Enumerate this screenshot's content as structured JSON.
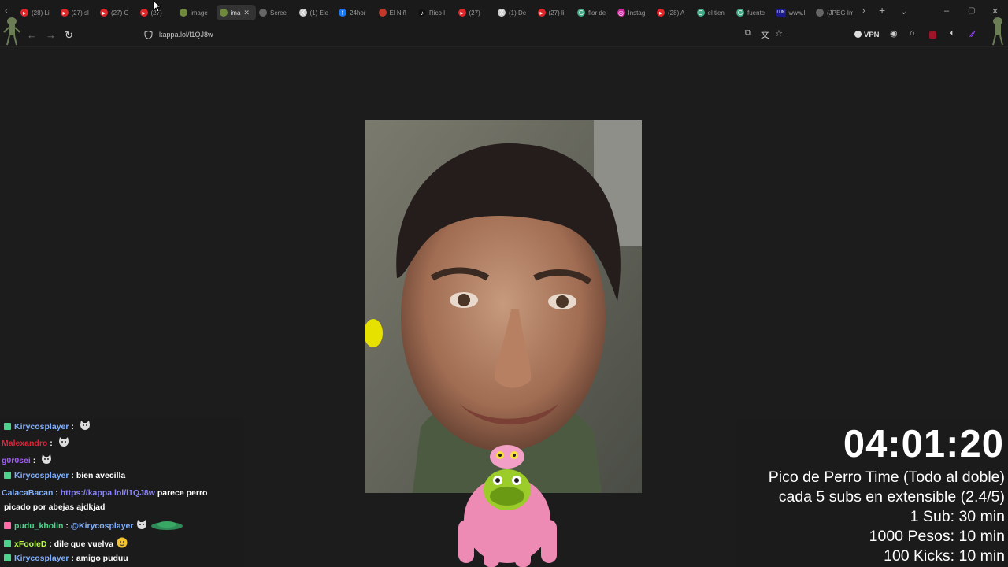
{
  "tabs": [
    {
      "label": "(28) Li",
      "icon": "youtube-icon"
    },
    {
      "label": "(27) sl",
      "icon": "youtube-icon"
    },
    {
      "label": "(27) C",
      "icon": "youtube-icon"
    },
    {
      "label": "(27) ",
      "icon": "youtube-icon"
    },
    {
      "label": "image",
      "icon": "frog-icon"
    },
    {
      "label": "ima",
      "icon": "frog-icon",
      "active": true
    },
    {
      "label": "Scree",
      "icon": "page-icon"
    },
    {
      "label": "(1) Ele",
      "icon": "x-icon"
    },
    {
      "label": "24hor",
      "icon": "facebook-icon"
    },
    {
      "label": "El Niñ",
      "icon": "site-icon"
    },
    {
      "label": "Rico l",
      "icon": "tiktok-icon"
    },
    {
      "label": "(27) ",
      "icon": "youtube-icon"
    },
    {
      "label": "(1) De",
      "icon": "x-icon"
    },
    {
      "label": "(27) li",
      "icon": "youtube-icon"
    },
    {
      "label": "flor de",
      "icon": "google-icon"
    },
    {
      "label": "Instag",
      "icon": "instagram-icon"
    },
    {
      "label": "(28) A",
      "icon": "youtube-icon"
    },
    {
      "label": "el tien",
      "icon": "google-icon"
    },
    {
      "label": "fuente",
      "icon": "google-icon"
    },
    {
      "label": "www.l",
      "icon": "lun-icon"
    },
    {
      "label": "(JPEG Ima",
      "icon": "page-icon"
    }
  ],
  "lun_badge": "LUN",
  "address_bar": {
    "url": "kappa.lol/l1QJ8w"
  },
  "vpn_label": "VPN",
  "chat": [
    {
      "user": "Kirycosplayer",
      "color": "#7fb0ff",
      "text": "",
      "badge": true,
      "emote": "cat"
    },
    {
      "user": "Malexandro",
      "color": "#d9263a",
      "text": "",
      "badge": false,
      "emote": "cat"
    },
    {
      "user": "g0r0sei",
      "color": "#a35cff",
      "text": "",
      "badge": false,
      "emote": "cat"
    },
    {
      "user": "Kirycosplayer",
      "color": "#7fb0ff",
      "text": "bien avecilla",
      "badge": true
    },
    {
      "user": "CalacaBacan",
      "color": "#7fb0ff",
      "text": "parece perro",
      "link": "https://kappa.lol/l1QJ8w",
      "badge": false,
      "cont": "picado por abejas ajdkjad"
    },
    {
      "user": "pudu_kholin",
      "color": "#4cd48c",
      "text": "",
      "mention": "@Kirycosplayer",
      "badge": true,
      "emote": "cat"
    },
    {
      "user": "xFooleD",
      "color": "#b6ff3a",
      "text": "dile que vuelva",
      "badge": true,
      "emote": "smile"
    },
    {
      "user": "Kirycosplayer",
      "color": "#7fb0ff",
      "text": "amigo puduu",
      "badge": true
    }
  ],
  "overlay": {
    "timer": "04:01:20",
    "lines": [
      "Pico de Perro Time (Todo al doble)",
      "cada 5 subs en extensible (2.4/5)",
      "1 Sub: 30 min",
      "1000 Pesos: 10 min",
      "100 Kicks: 10 min"
    ]
  },
  "colors": {
    "badge_green": "#4cd48c",
    "badge_pink": "#ff6aa9",
    "accent_purple": "#8a83ff"
  }
}
